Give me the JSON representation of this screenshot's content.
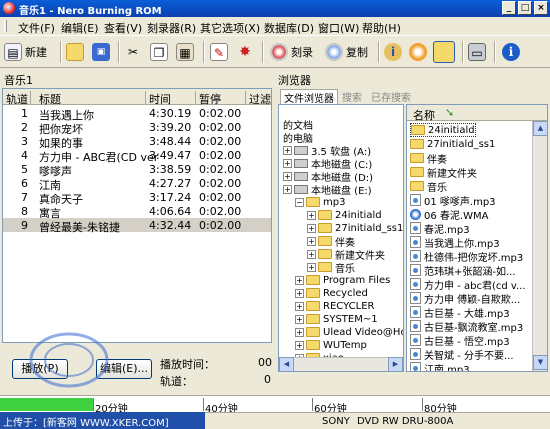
{
  "window": {
    "title": "音乐1 - Nero Burning ROM",
    "controls": [
      "_",
      "□",
      "×"
    ]
  },
  "menu": [
    "文件(F)",
    "编辑(E)",
    "查看(V)",
    "刻录器(R)",
    "其它选项(X)",
    "数据库(D)",
    "窗口(W)",
    "帮助(H)"
  ],
  "toolbar": {
    "new_label": "新建",
    "burn_label": "刻录",
    "copy_label": "复制"
  },
  "compilation": {
    "title": "音乐1",
    "columns": [
      "轨道",
      "标题",
      "时间",
      "暂停",
      "过滤器"
    ],
    "tracks": [
      {
        "no": "1",
        "title": "当我遇上你",
        "time": "4:30.19",
        "pause": "0:02.00"
      },
      {
        "no": "2",
        "title": "把你宠坏",
        "time": "3:39.20",
        "pause": "0:02.00"
      },
      {
        "no": "3",
        "title": "如果的事",
        "time": "3:48.44",
        "pause": "0:02.00"
      },
      {
        "no": "4",
        "title": "方力申 - ABC君(CD ver",
        "time": "3:49.47",
        "pause": "0:02.00"
      },
      {
        "no": "5",
        "title": "嗲嗲声",
        "time": "3:38.59",
        "pause": "0:02.00"
      },
      {
        "no": "6",
        "title": "江南",
        "time": "4:27.27",
        "pause": "0:02.00"
      },
      {
        "no": "7",
        "title": "真命天子",
        "time": "3:17.24",
        "pause": "0:02.00"
      },
      {
        "no": "8",
        "title": "寓言",
        "time": "4:06.64",
        "pause": "0:02.00"
      },
      {
        "no": "9",
        "title": "曾经最美-朱铭捷",
        "time": "4:32.44",
        "pause": "0:02.00"
      }
    ],
    "play_label": "播放(P)",
    "edit_label": "编辑(E)...",
    "play_time_label": "播放时间：",
    "play_time_value": "00",
    "track_label": "轨道：",
    "track_value": "0"
  },
  "browser": {
    "title": "浏览器",
    "tabs": [
      "文件浏览器",
      "搜索",
      "已存搜索"
    ],
    "tree": [
      {
        "label": "的文档",
        "indent": 0,
        "icon": "none"
      },
      {
        "label": "的电脑",
        "indent": 0,
        "icon": "none"
      },
      {
        "label": "3.5 软盘 (A:)",
        "indent": 0,
        "icon": "drive"
      },
      {
        "label": "本地磁盘 (C:)",
        "indent": 0,
        "icon": "drive"
      },
      {
        "label": "本地磁盘 (D:)",
        "indent": 0,
        "icon": "drive"
      },
      {
        "label": "本地磁盘 (E:)",
        "indent": 0,
        "icon": "drive"
      },
      {
        "label": "mp3",
        "indent": 1,
        "icon": "folder"
      },
      {
        "label": "24initiald",
        "indent": 2,
        "icon": "folder"
      },
      {
        "label": "27initiald_ss1",
        "indent": 2,
        "icon": "folder"
      },
      {
        "label": "伴奏",
        "indent": 2,
        "icon": "folder"
      },
      {
        "label": "新建文件夹",
        "indent": 2,
        "icon": "folder"
      },
      {
        "label": "音乐",
        "indent": 2,
        "icon": "folder"
      },
      {
        "label": "Program Files",
        "indent": 1,
        "icon": "folder"
      },
      {
        "label": "Recycled",
        "indent": 1,
        "icon": "folder"
      },
      {
        "label": "RECYCLER",
        "indent": 1,
        "icon": "folder"
      },
      {
        "label": "SYSTEM~1",
        "indent": 1,
        "icon": "folder"
      },
      {
        "label": "Ulead Video@Home",
        "indent": 1,
        "icon": "folder"
      },
      {
        "label": "WUTemp",
        "indent": 1,
        "icon": "folder"
      },
      {
        "label": "xiao",
        "indent": 1,
        "icon": "folder"
      }
    ],
    "file_column": "名称",
    "files": [
      {
        "name": "24initiald",
        "type": "folder"
      },
      {
        "name": "27initiald_ss1",
        "type": "folder"
      },
      {
        "name": "伴奏",
        "type": "folder"
      },
      {
        "name": "新建文件夹",
        "type": "folder"
      },
      {
        "name": "音乐",
        "type": "folder"
      },
      {
        "name": "01 嗲嗲声.mp3",
        "type": "mp3"
      },
      {
        "name": "06 春泥.WMA",
        "type": "wma"
      },
      {
        "name": "春泥.mp3",
        "type": "mp3"
      },
      {
        "name": "当我遇上你.mp3",
        "type": "mp3"
      },
      {
        "name": "杜德伟-把你宠坏.mp3",
        "type": "mp3"
      },
      {
        "name": "范玮琪+张韶涵-如...",
        "type": "mp3"
      },
      {
        "name": "方力申 - abc君(cd v...",
        "type": "mp3"
      },
      {
        "name": "方力申 傅颖-自欺欺...",
        "type": "mp3"
      },
      {
        "name": "古巨基 - 大雄.mp3",
        "type": "mp3"
      },
      {
        "name": "古巨基-飘流教室.mp3",
        "type": "mp3"
      },
      {
        "name": "古巨基 - 悟空.mp3",
        "type": "mp3"
      },
      {
        "name": "关智斌 - 分手不要...",
        "type": "mp3"
      },
      {
        "name": "江南.mp3",
        "type": "mp3"
      }
    ]
  },
  "capacity": {
    "used_fraction": 0.17,
    "markers": [
      "20分钟",
      "40分钟",
      "60分钟",
      "80分钟"
    ],
    "accent_color": "#3fd13f"
  },
  "status": {
    "watermark": "上传于：[新客网 WWW.XKER.COM]",
    "drive_vendor": "SONY",
    "drive_model": "DVD RW DRU-800A"
  }
}
